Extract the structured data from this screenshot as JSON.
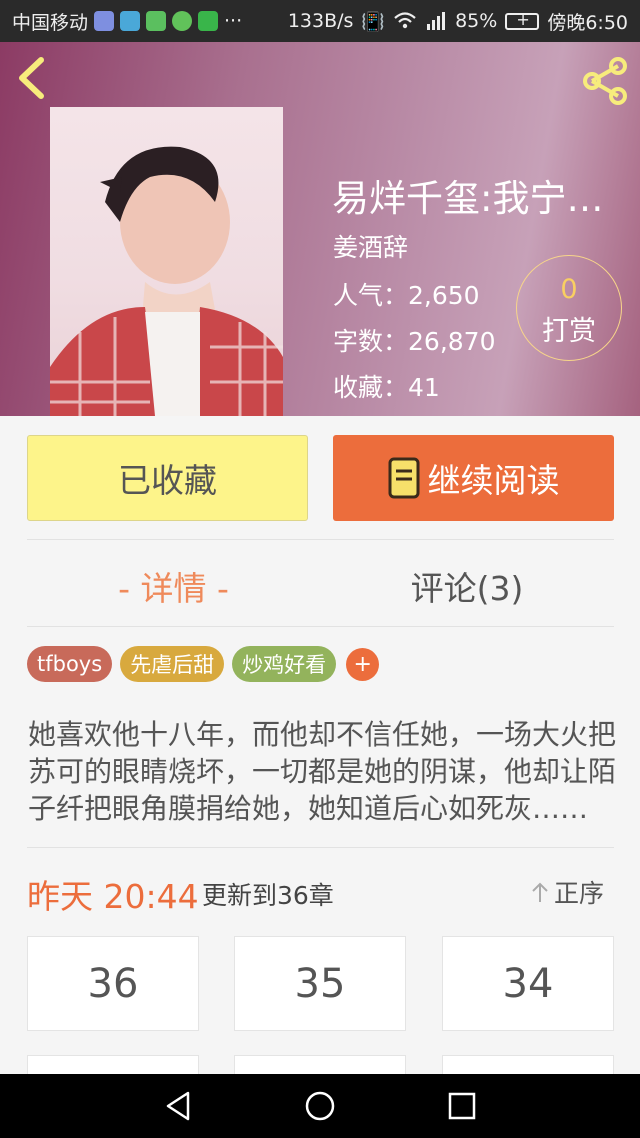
{
  "status_bar": {
    "carrier": "中国移动",
    "more": "···",
    "net_speed": "133B/s",
    "battery": "85%",
    "time": "傍晚6:50"
  },
  "book": {
    "title": "易烊千玺:我宁愿你从未出现",
    "author": "姜酒辞",
    "stats": {
      "popularity_label": "人气：",
      "popularity": "2,650",
      "words_label": "字数：",
      "words": "26,870",
      "favorites_label": "收藏：",
      "favorites": "41"
    },
    "reward": {
      "count": "0",
      "label": "打赏"
    }
  },
  "actions": {
    "collected_label": "已收藏",
    "continue_label": "继续阅读"
  },
  "tabs": {
    "detail": "- 详情 -",
    "comments": "评论(3)"
  },
  "tags": [
    {
      "label": "tfboys",
      "color": "#c86a5a"
    },
    {
      "label": "先虐后甜",
      "color": "#d8a93e"
    },
    {
      "label": "炒鸡好看",
      "color": "#93b35c"
    }
  ],
  "tag_add": "+",
  "synopsis": "她喜欢他十八年，而他却不信任她，一场大火把苏可的眼睛烧坏，一切都是她的阴谋，他却让陌子纤把眼角膜捐给她，她知道后心如死灰……",
  "update": {
    "time": "昨天 20:44",
    "text": "更新到36章",
    "sort_label": "正序"
  },
  "chapters": [
    "36",
    "35",
    "34"
  ],
  "icons": {
    "back": "back-arrow-icon",
    "share": "share-icon",
    "book": "book-icon",
    "sort": "arrow-up-icon",
    "nav_back": "triangle-back-icon",
    "nav_home": "circle-home-icon",
    "nav_recent": "square-recent-icon"
  },
  "colors": {
    "accent": "#ec6d3c",
    "collected_bg": "#fdf48a",
    "reward_ring": "#f7d58a",
    "reward_num": "#f9cf62"
  }
}
